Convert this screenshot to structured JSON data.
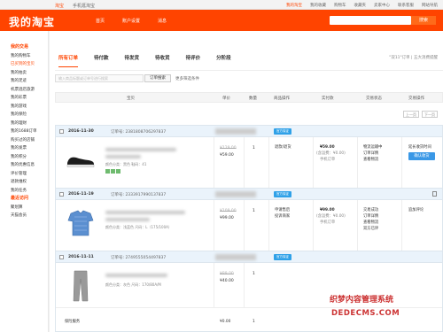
{
  "topbar": {
    "left_items": [
      "淘宝",
      "手机逛淘宝"
    ],
    "right_items": [
      "我的淘宝",
      "我的收藏",
      "购物车",
      "收藏夹",
      "卖家中心",
      "联系客服",
      "网站导航"
    ]
  },
  "header": {
    "logo": "我的淘宝",
    "nav": [
      "首页",
      "账户设置",
      "消息"
    ],
    "search_button": "搜索"
  },
  "sidebar": {
    "items": [
      {
        "label": "我的交易",
        "kind": "sec"
      },
      {
        "label": "我的购物车",
        "kind": "item"
      },
      {
        "label": "已买到的宝贝",
        "kind": "active"
      },
      {
        "label": "我的拍卖",
        "kind": "item"
      },
      {
        "label": "我的足迹",
        "kind": "item"
      },
      {
        "label": "机票酒店旅游",
        "kind": "item"
      },
      {
        "label": "我的彩票",
        "kind": "item"
      },
      {
        "label": "我的游戏",
        "kind": "item"
      },
      {
        "label": "我的保险",
        "kind": "item"
      },
      {
        "label": "我的理财",
        "kind": "item"
      },
      {
        "label": "我的1688订单",
        "kind": "item"
      },
      {
        "label": "购买过的店铺",
        "kind": "item"
      },
      {
        "label": "我的发票",
        "kind": "item"
      },
      {
        "label": "我的积分",
        "kind": "item"
      },
      {
        "label": "我的优惠信息",
        "kind": "item"
      },
      {
        "label": "评价管理",
        "kind": "item"
      },
      {
        "label": "退款维权",
        "kind": "item"
      },
      {
        "label": "我的任务",
        "kind": "item"
      },
      {
        "label": "最近访问",
        "kind": "sec"
      },
      {
        "label": "聚划算",
        "kind": "item"
      },
      {
        "label": "天猫会员",
        "kind": "item"
      }
    ]
  },
  "tabs": {
    "items": [
      "所有订单",
      "待付款",
      "待发货",
      "待收货",
      "待评价",
      "分阶段"
    ],
    "right_text": "\"双11\"订单 | 五大消费提醒"
  },
  "search": {
    "placeholder": "输入商品标题或订单号进行搜索",
    "button": "订单搜索",
    "more": "更多筛选条件"
  },
  "columns": [
    "宝贝",
    "单价",
    "数量",
    "商品操作",
    "实付款",
    "交易状态",
    "交易操作"
  ],
  "pager": {
    "prev": "上一页",
    "next": "下一页"
  },
  "orders": [
    {
      "date": "2016-11-30",
      "order_label": "订单号: 2381808706297837",
      "badge": "官方保证",
      "original_price": "¥129.00",
      "price": "¥59.00",
      "qty": "1",
      "goods_ops": [
        "退款/退货"
      ],
      "paid": "¥59.00",
      "paid_note": "(含运费：¥0.00)",
      "paid_extra": "手机订单",
      "status": [
        "物流运输中",
        "订单详情",
        "查看物流"
      ],
      "ops_button": "确认收货",
      "ops_extra": "延长收货时间",
      "attrs": "颜色分类：黑色  鞋码：41"
    },
    {
      "date": "2016-11-19",
      "order_label": "订单号: 2333917990137837",
      "badge": "官方保证",
      "original_price": "¥109.00",
      "price": "¥99.00",
      "qty": "1",
      "goods_ops": [
        "申请售后",
        "投诉商家"
      ],
      "paid": "¥99.00",
      "paid_note": "(含运费：¥0.00)",
      "paid_extra": "手机订单",
      "status": [
        "交易成功",
        "订单详情",
        "查看物流",
        "双方已评"
      ],
      "ops_text": "追加评论",
      "attrs": "颜色分类：浅蓝色  尺码：L（175/100A）"
    },
    {
      "date": "2016-11-11",
      "order_label": "订单号: 2749555054497837",
      "badge": "官方保证",
      "original_price": "¥89.00",
      "price": "¥40.00",
      "qty": "1",
      "attrs": "颜色分类：灰色  尺码：170/80A/M"
    }
  ],
  "footer_row": {
    "label": "保险服务",
    "price": "¥0.00",
    "qty": "1"
  },
  "watermark": {
    "line1": "织梦内容管理系统",
    "line2": "DEDECMS.COM"
  }
}
